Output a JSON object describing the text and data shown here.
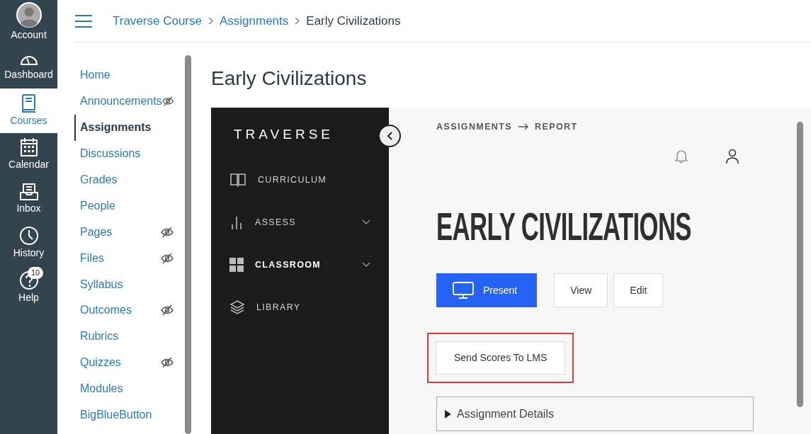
{
  "global_nav": [
    {
      "label": "Account",
      "kind": "avatar",
      "selected": false
    },
    {
      "label": "Dashboard",
      "kind": "gauge",
      "selected": false
    },
    {
      "label": "Courses",
      "kind": "book",
      "selected": true
    },
    {
      "label": "Calendar",
      "kind": "calendar",
      "selected": false
    },
    {
      "label": "Inbox",
      "kind": "inbox",
      "selected": false
    },
    {
      "label": "History",
      "kind": "clock",
      "selected": false
    },
    {
      "label": "Help",
      "kind": "help",
      "selected": false,
      "badge": "10"
    }
  ],
  "breadcrumbs": [
    "Traverse Course",
    "Assignments",
    "Early Civilizations"
  ],
  "course_nav": [
    {
      "label": "Home",
      "selected": false,
      "hidden": false
    },
    {
      "label": "Announcements",
      "selected": false,
      "hidden": true
    },
    {
      "label": "Assignments",
      "selected": true,
      "hidden": false
    },
    {
      "label": "Discussions",
      "selected": false,
      "hidden": false
    },
    {
      "label": "Grades",
      "selected": false,
      "hidden": false
    },
    {
      "label": "People",
      "selected": false,
      "hidden": false
    },
    {
      "label": "Pages",
      "selected": false,
      "hidden": true
    },
    {
      "label": "Files",
      "selected": false,
      "hidden": true
    },
    {
      "label": "Syllabus",
      "selected": false,
      "hidden": false
    },
    {
      "label": "Outcomes",
      "selected": false,
      "hidden": true
    },
    {
      "label": "Rubrics",
      "selected": false,
      "hidden": false
    },
    {
      "label": "Quizzes",
      "selected": false,
      "hidden": true
    },
    {
      "label": "Modules",
      "selected": false,
      "hidden": false
    },
    {
      "label": "BigBlueButton",
      "selected": false,
      "hidden": false
    }
  ],
  "page_title": "Early Civilizations",
  "app": {
    "logo": "TRAVERSE",
    "menu": [
      {
        "label": "CURRICULUM",
        "kind": "book",
        "selected": false,
        "expandable": false
      },
      {
        "label": "ASSESS",
        "kind": "bars",
        "selected": false,
        "expandable": true
      },
      {
        "label": "CLASSROOM",
        "kind": "grid",
        "selected": true,
        "expandable": true
      },
      {
        "label": "LIBRARY",
        "kind": "layers",
        "selected": false,
        "expandable": false
      }
    ],
    "breadcrumb": [
      "ASSIGNMENTS",
      "REPORT"
    ],
    "title": "EARLY CIVILIZATIONS",
    "buttons": [
      {
        "label": "Present",
        "kind": "primary"
      },
      {
        "label": "View",
        "kind": "outline"
      },
      {
        "label": "Edit",
        "kind": "outline"
      }
    ],
    "send_button": {
      "label": "Send Scores To LMS",
      "highlighted": true
    },
    "details": {
      "label": "Assignment Details",
      "expanded": false
    }
  }
}
